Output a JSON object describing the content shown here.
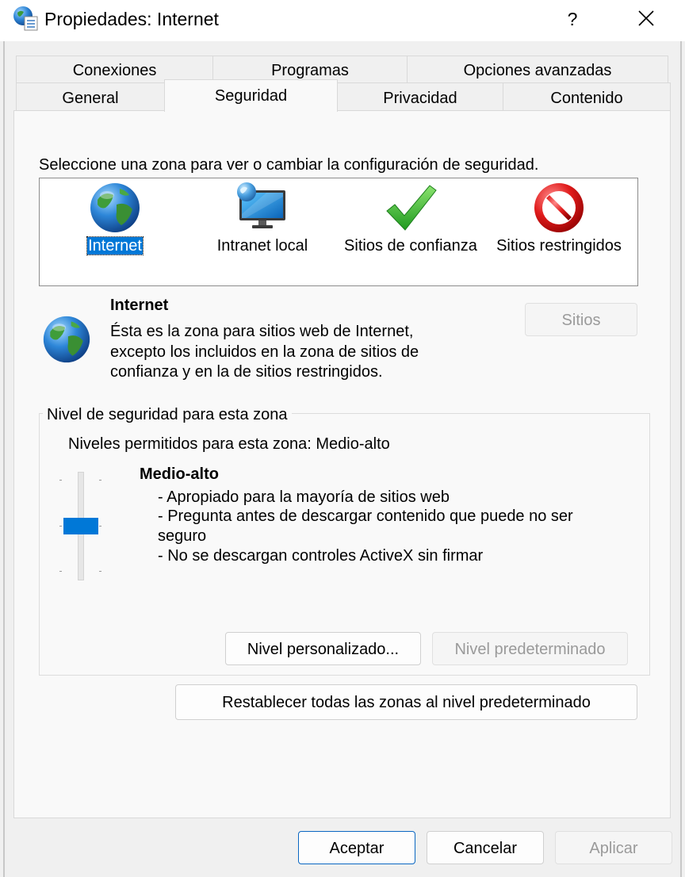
{
  "window": {
    "title": "Propiedades: Internet",
    "help_label": "?"
  },
  "tabs_row_back": [
    {
      "label": "Conexiones"
    },
    {
      "label": "Programas"
    },
    {
      "label": "Opciones avanzadas"
    }
  ],
  "tabs_row_front": [
    {
      "label": "General"
    },
    {
      "label": "Seguridad",
      "active": true
    },
    {
      "label": "Privacidad"
    },
    {
      "label": "Contenido"
    }
  ],
  "security": {
    "zone_prompt": "Seleccione una zona para ver o cambiar la configuración de seguridad.",
    "zones": [
      {
        "label": "Internet",
        "icon": "globe-icon",
        "selected": true
      },
      {
        "label": "Intranet local",
        "icon": "intranet-monitor-icon"
      },
      {
        "label": "Sitios de confianza",
        "icon": "checkmark-icon"
      },
      {
        "label": "Sitios restringidos",
        "icon": "no-entry-icon"
      }
    ],
    "zone_info": {
      "name": "Internet",
      "description_lines": [
        "Ésta es la zona para sitios web de Internet,",
        "excepto los incluidos en la zona de sitios de",
        "confianza y en la de sitios restringidos."
      ],
      "sites_button": "Sitios"
    },
    "level_group": {
      "title": "Nivel de seguridad para esta zona",
      "allowed_levels": "Niveles permitidos para esta zona: Medio-alto",
      "level_name": "Medio-alto",
      "level_details": [
        "- Apropiado para la mayoría de sitios web",
        "- Pregunta antes de descargar contenido que puede no ser",
        "seguro",
        "- No se descargan controles ActiveX sin firmar"
      ],
      "slider_position": "Medio-alto",
      "custom_level_button": "Nivel personalizado...",
      "default_level_button": "Nivel predeterminado"
    },
    "reset_all_button": "Restablecer todas las zonas al nivel predeterminado"
  },
  "footer": {
    "ok": "Aceptar",
    "cancel": "Cancelar",
    "apply": "Aplicar"
  },
  "colors": {
    "accent": "#0078d7",
    "disabled_text": "#9a9a9a"
  }
}
